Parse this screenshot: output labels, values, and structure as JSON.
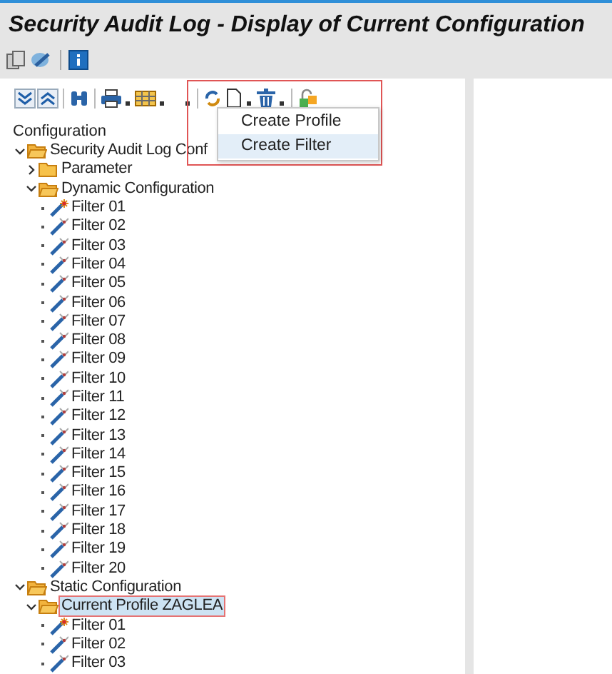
{
  "window": {
    "title": "Security Audit Log - Display of Current Configuration"
  },
  "tree": {
    "header": "Configuration",
    "nodes": [
      {
        "label": "Security Audit Log Conf",
        "kind": "folder",
        "expanded": true,
        "selected": false,
        "children": [
          {
            "label": "Parameter",
            "kind": "folder",
            "expanded": false,
            "selected": false
          },
          {
            "label": "Dynamic Configuration",
            "kind": "folder",
            "expanded": true,
            "selected": false,
            "children": [
              {
                "label": "Filter 01",
                "kind": "filter",
                "active": true,
                "selected": false
              },
              {
                "label": "Filter 02",
                "kind": "filter",
                "active": false,
                "selected": false
              },
              {
                "label": "Filter 03",
                "kind": "filter",
                "active": false,
                "selected": false
              },
              {
                "label": "Filter 04",
                "kind": "filter",
                "active": false,
                "selected": false
              },
              {
                "label": "Filter 05",
                "kind": "filter",
                "active": false,
                "selected": false
              },
              {
                "label": "Filter 06",
                "kind": "filter",
                "active": false,
                "selected": false
              },
              {
                "label": "Filter 07",
                "kind": "filter",
                "active": false,
                "selected": false
              },
              {
                "label": "Filter 08",
                "kind": "filter",
                "active": false,
                "selected": false
              },
              {
                "label": "Filter 09",
                "kind": "filter",
                "active": false,
                "selected": false
              },
              {
                "label": "Filter 10",
                "kind": "filter",
                "active": false,
                "selected": false
              },
              {
                "label": "Filter 11",
                "kind": "filter",
                "active": false,
                "selected": false
              },
              {
                "label": "Filter 12",
                "kind": "filter",
                "active": false,
                "selected": false
              },
              {
                "label": "Filter 13",
                "kind": "filter",
                "active": false,
                "selected": false
              },
              {
                "label": "Filter 14",
                "kind": "filter",
                "active": false,
                "selected": false
              },
              {
                "label": "Filter 15",
                "kind": "filter",
                "active": false,
                "selected": false
              },
              {
                "label": "Filter 16",
                "kind": "filter",
                "active": false,
                "selected": false
              },
              {
                "label": "Filter 17",
                "kind": "filter",
                "active": false,
                "selected": false
              },
              {
                "label": "Filter 18",
                "kind": "filter",
                "active": false,
                "selected": false
              },
              {
                "label": "Filter 19",
                "kind": "filter",
                "active": false,
                "selected": false
              },
              {
                "label": "Filter 20",
                "kind": "filter",
                "active": false,
                "selected": false
              }
            ]
          }
        ]
      },
      {
        "label": "Static Configuration",
        "kind": "folder",
        "expanded": true,
        "selected": false,
        "children": [
          {
            "label": "Current Profile ZAGLEA",
            "kind": "folder",
            "expanded": true,
            "selected": true,
            "children": [
              {
                "label": "Filter 01",
                "kind": "filter",
                "active": true,
                "selected": false
              },
              {
                "label": "Filter 02",
                "kind": "filter",
                "active": false,
                "selected": false
              },
              {
                "label": "Filter 03",
                "kind": "filter",
                "active": false,
                "selected": false
              }
            ]
          }
        ]
      }
    ]
  },
  "menu": {
    "items": [
      {
        "label": "Create Profile",
        "selected": false
      },
      {
        "label": "Create Filter",
        "selected": true
      }
    ]
  }
}
